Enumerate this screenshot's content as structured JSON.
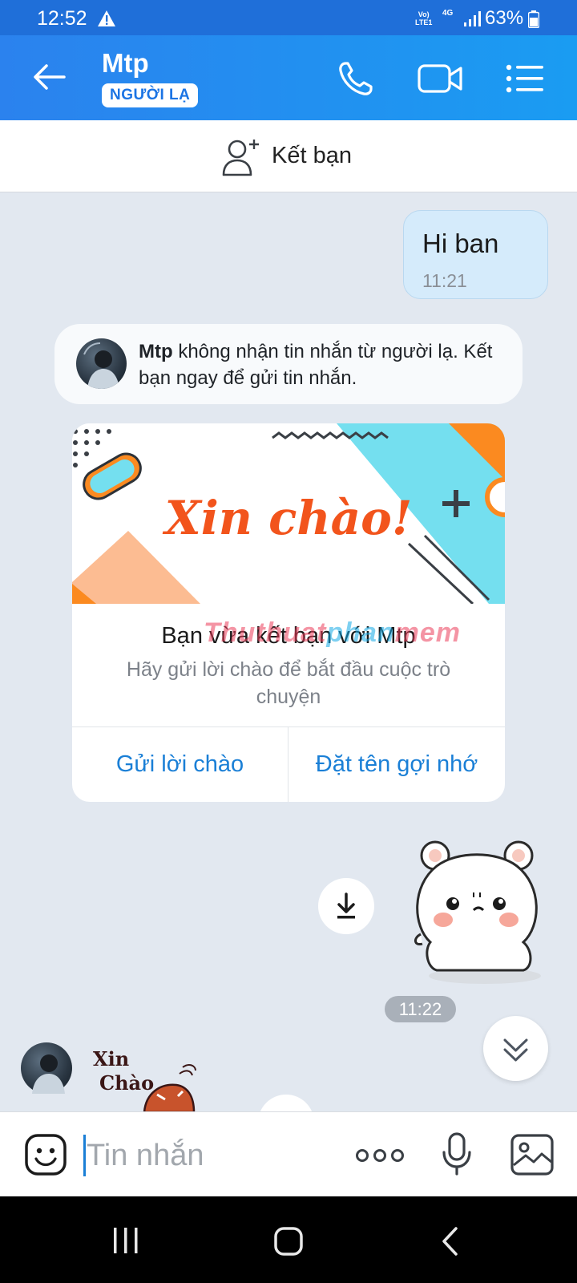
{
  "status_bar": {
    "time": "12:52",
    "network_top": "Vo)",
    "network_bottom": "LTE1",
    "network_type": "4G",
    "battery": "63%"
  },
  "header": {
    "contact_name": "Mtp",
    "badge": "NGƯỜI LẠ",
    "icons": [
      "back-arrow-icon",
      "phone-icon",
      "video-camera-icon",
      "menu-list-icon"
    ]
  },
  "add_friend": {
    "label": "Kết bạn"
  },
  "messages": {
    "outgoing_text": "Hi ban",
    "outgoing_time": "11:21",
    "notice_name": "Mtp",
    "notice_text": " không nhận tin nhắn từ người lạ. Kết bạn ngay để gửi tin nhắn.",
    "sticker_time": "11:22"
  },
  "card": {
    "banner_text": "Xin chào!",
    "title": "Bạn vừa kết bạn với Mtp",
    "subtitle": "Hãy gửi lời chào để bắt đầu cuộc trò chuyện",
    "send_greeting": "Gửi lời chào",
    "set_nickname": "Đặt tên gợi nhớ"
  },
  "watermark": {
    "part1": "Thuthuat",
    "part2": "phan",
    "part3": "mem"
  },
  "sticker2": {
    "line1": "Xin",
    "line2": "Chào"
  },
  "input": {
    "placeholder": "Tin nhắn"
  },
  "colors": {
    "brand": "#1f6fd9",
    "link": "#1a7fd6",
    "bubble": "#d5ebfb"
  }
}
